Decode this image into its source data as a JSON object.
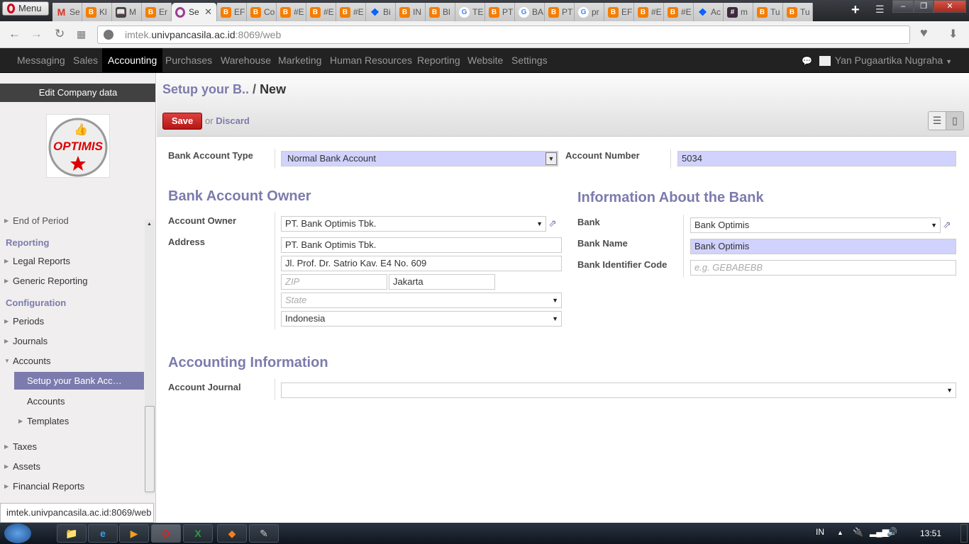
{
  "browser": {
    "menu_label": "Menu",
    "tabs": [
      {
        "icon": "gmail",
        "label": "Se"
      },
      {
        "icon": "blogger",
        "label": "Kl"
      },
      {
        "icon": "book",
        "label": "M"
      },
      {
        "icon": "blogger",
        "label": "Er"
      },
      {
        "icon": "opera",
        "label": "Se",
        "active": true
      },
      {
        "icon": "blogger",
        "label": "EF"
      },
      {
        "icon": "blogger",
        "label": "Co"
      },
      {
        "icon": "blogger",
        "label": "#E"
      },
      {
        "icon": "blogger",
        "label": "#E"
      },
      {
        "icon": "blogger",
        "label": "#E"
      },
      {
        "icon": "dropbox",
        "label": "Bi"
      },
      {
        "icon": "blogger",
        "label": "IN"
      },
      {
        "icon": "blogger",
        "label": "Bl"
      },
      {
        "icon": "google",
        "label": "TE"
      },
      {
        "icon": "blogger",
        "label": "PT"
      },
      {
        "icon": "google",
        "label": "BA"
      },
      {
        "icon": "blogger",
        "label": "PT"
      },
      {
        "icon": "google",
        "label": "pr"
      },
      {
        "icon": "blogger",
        "label": "EF"
      },
      {
        "icon": "blogger",
        "label": "#E"
      },
      {
        "icon": "blogger",
        "label": "#E"
      },
      {
        "icon": "dropbox",
        "label": "Ac"
      },
      {
        "icon": "hash",
        "label": "m"
      },
      {
        "icon": "blogger",
        "label": "Tu"
      },
      {
        "icon": "blogger",
        "label": "Tu"
      }
    ],
    "url_prefix": "imtek.",
    "url_host": "univpancasila.ac.id",
    "url_suffix": ":8069/web",
    "status_url": "imtek.univpancasila.ac.id:8069/web"
  },
  "topnav": {
    "items": [
      "Messaging",
      "Sales",
      "Accounting",
      "Purchases",
      "Warehouse",
      "Marketing",
      "Human Resources",
      "Reporting",
      "Website",
      "Settings"
    ],
    "active": "Accounting",
    "user": "Yan Pugaartika Nugraha"
  },
  "sidebar": {
    "edit_company": "Edit Company data",
    "logo_text": "OPTIMIS",
    "partial_item": "End of Period",
    "sections": {
      "reporting": "Reporting",
      "configuration": "Configuration"
    },
    "items": {
      "legal_reports": "Legal Reports",
      "generic_reporting": "Generic Reporting",
      "periods": "Periods",
      "journals": "Journals",
      "accounts": "Accounts",
      "setup_bank": "Setup your Bank Acc…",
      "accounts_sub": "Accounts",
      "templates": "Templates",
      "taxes": "Taxes",
      "assets": "Assets",
      "financial_reports": "Financial Reports"
    }
  },
  "header": {
    "breadcrumb_parent": "Setup your B..",
    "breadcrumb_sep": "/",
    "breadcrumb_current": "New",
    "save_label": "Save",
    "or_label": "or",
    "discard_label": "Discard"
  },
  "form": {
    "bank_account_type_label": "Bank Account Type",
    "bank_account_type_value": "Normal Bank Account",
    "account_number_label": "Account Number",
    "account_number_value": "5034",
    "owner_heading": "Bank Account Owner",
    "account_owner_label": "Account Owner",
    "account_owner_value": "PT. Bank Optimis Tbk.",
    "address_label": "Address",
    "street": "PT. Bank Optimis Tbk.",
    "street2": "Jl. Prof. Dr. Satrio Kav. E4 No. 609",
    "zip_placeholder": "ZIP",
    "city": "Jakarta",
    "state_placeholder": "State",
    "country": "Indonesia",
    "bank_heading": "Information About the Bank",
    "bank_label": "Bank",
    "bank_value": "Bank Optimis",
    "bank_name_label": "Bank Name",
    "bank_name_value": "Bank Optimis",
    "bic_label": "Bank Identifier Code",
    "bic_placeholder": "e.g. GEBABEBB",
    "accounting_heading": "Accounting Information",
    "journal_label": "Account Journal",
    "journal_value": ""
  },
  "taskbar": {
    "lang": "IN",
    "time": "13:51"
  },
  "colors": {
    "accent": "#7c7bad",
    "save": "#c42424",
    "required_field": "#d2d2ff",
    "nav_bg": "#222222"
  }
}
